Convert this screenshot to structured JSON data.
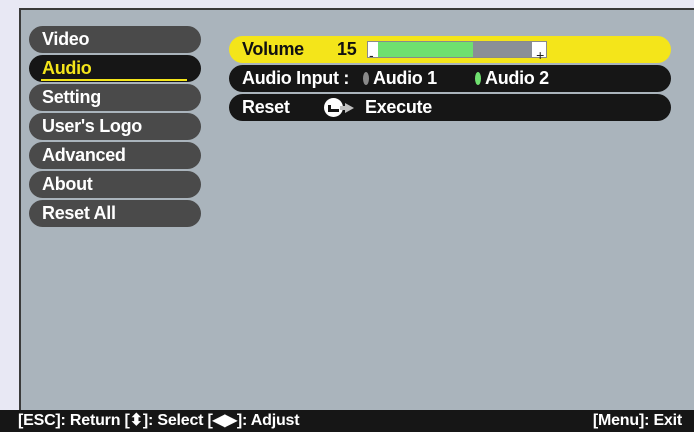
{
  "menu": {
    "items": [
      {
        "label": "Video",
        "active": false
      },
      {
        "label": "Audio",
        "active": true
      },
      {
        "label": "Setting",
        "active": false
      },
      {
        "label": "User's Logo",
        "active": false
      },
      {
        "label": "Advanced",
        "active": false
      },
      {
        "label": "About",
        "active": false
      },
      {
        "label": "Reset All",
        "active": false
      }
    ]
  },
  "settings": {
    "volume": {
      "label": "Volume",
      "value": "15",
      "level_fraction": 0.62,
      "minus": "-",
      "plus": "+"
    },
    "audio_input": {
      "label": "Audio Input :",
      "options": [
        "Audio 1",
        "Audio 2"
      ],
      "selected": "Audio 2"
    },
    "reset": {
      "label": "Reset",
      "action": "Execute",
      "icons": [
        "enter-icon",
        "arrow-right-icon"
      ]
    }
  },
  "footer": {
    "left": "[ESC]: Return [⬍]: Select [◀▶]: Adjust",
    "right": "[Menu]: Exit"
  },
  "colors": {
    "panel": "#aab4bc",
    "highlight": "#f4e51a",
    "menu_item": "#4a4a4a",
    "active_bg": "#161616",
    "bar_fill": "#6fe06f"
  }
}
